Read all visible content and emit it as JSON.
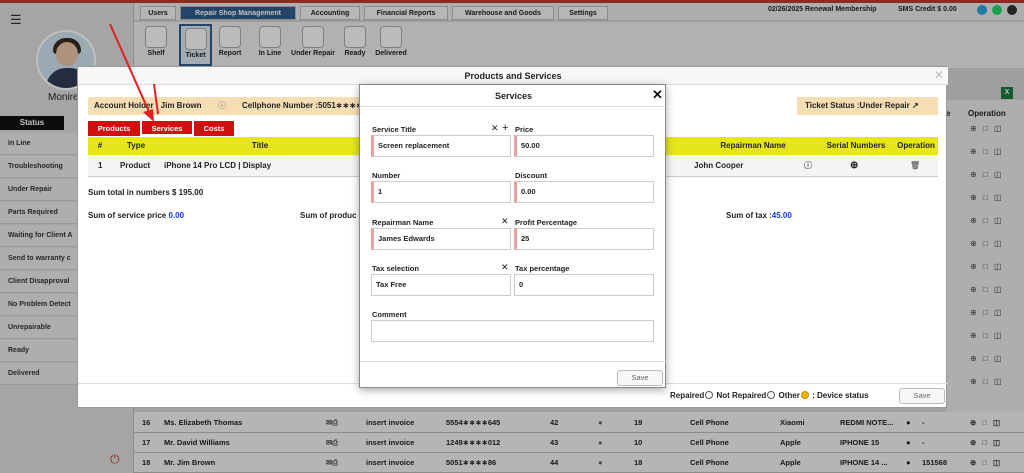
{
  "sidebar": {
    "username": "Monire",
    "status_heading": "Status",
    "items": [
      "In Line",
      "Troubleshooting",
      "Under Repair",
      "Parts Required",
      "Waiting for Client A",
      "Send to warranty c",
      "Client Disapproval",
      "No Problem Detect",
      "Unrepairable",
      "Ready",
      "Delivered"
    ]
  },
  "topnav": {
    "tabs": [
      "Users",
      "Repair Shop Management",
      "Accounting",
      "Financial Reports",
      "Warehouse and Goods",
      "Settings"
    ],
    "renewal": "02/26/2025 Renewal Membership",
    "sms_credit": "SMS Credit $ 0.00"
  },
  "toolbar": {
    "tools": [
      "Shelf",
      "Ticket",
      "Report",
      "In Line",
      "Under Repair",
      "Ready",
      "Delivered"
    ]
  },
  "background_table": {
    "header_e": "e",
    "header_operation": "Operation",
    "rows": [
      {
        "num": "16",
        "name": "Ms. Elizabeth Thomas",
        "invoice": "insert invoice",
        "phone": "5554∗∗∗∗645",
        "a": "42",
        "b": "19",
        "device": "Cell Phone",
        "brand": "Xiaomi",
        "model": "REDMI NOTE...",
        "extra": "-"
      },
      {
        "num": "17",
        "name": "Mr. David Williams",
        "invoice": "insert invoice",
        "phone": "1249∗∗∗∗012",
        "a": "43",
        "b": "10",
        "device": "Cell Phone",
        "brand": "Apple",
        "model": "IPHONE 15",
        "extra": "-"
      },
      {
        "num": "18",
        "name": "Mr. Jim Brown",
        "invoice": "insert invoice",
        "phone": "5051∗∗∗∗86",
        "a": "44",
        "b": "18",
        "device": "Cell Phone",
        "brand": "Apple",
        "model": "IPHONE 14 ...",
        "extra": "151568"
      }
    ]
  },
  "products_modal": {
    "title": "Products and Services",
    "account_holder": "Account Holder : Jim Brown",
    "cellphone": "Cellphone Number :5051∗∗∗∗",
    "ticket_status": "Ticket Status :Under Repair",
    "tabs": [
      "Products",
      "Services",
      "Costs"
    ],
    "columns": [
      "#",
      "Type",
      "Title",
      "Repairman Name",
      "Serial Numbers",
      "Operation"
    ],
    "row": {
      "num": "1",
      "type": "Product",
      "title": "iPhone 14 Pro LCD | Display",
      "repairman": "John Cooper"
    },
    "sum_total": "Sum total in numbers $ 195.00",
    "sum_service_label": "Sum of service price",
    "sum_service_value": "0.00",
    "sum_product_label": "Sum of produc",
    "sum_tax_label": "Sum of tax :",
    "sum_tax_value": "45.00",
    "device_status": {
      "repaired": "Repaired",
      "not_repaired": "Not Repaired",
      "other": "Other",
      "label": ": Device status"
    },
    "save": "Save"
  },
  "services_modal": {
    "title": "Services",
    "service_title_label": "Service Title",
    "service_title_value": "Screen replacement",
    "price_label": "Price",
    "price_value": "50.00",
    "number_label": "Number",
    "number_value": "1",
    "discount_label": "Discount",
    "discount_value": "0.00",
    "repairman_label": "Repairman Name",
    "repairman_value": "James Edwards",
    "profit_label": "Profit Percentage",
    "profit_value": "25",
    "tax_label": "Tax selection",
    "tax_value": "Tax Free",
    "tax_percent_label": "Tax percentage",
    "tax_percent_value": "0",
    "comment_label": "Comment",
    "comment_value": "",
    "save": "Save"
  },
  "colors": {
    "accent": "#2f5d8a",
    "tab_red": "#d20f0f",
    "header_yellow": "#e6e61a",
    "account_bar": "#f5deb3",
    "arrow": "#e02020"
  }
}
